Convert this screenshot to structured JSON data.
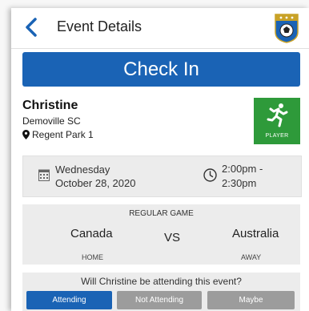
{
  "header": {
    "title": "Event Details",
    "back_icon": "chevron-left-icon",
    "logo_icon": "soccer-team-badge-icon"
  },
  "checkin": {
    "label": "Check In",
    "color": "#1a63b5"
  },
  "player": {
    "name": "Christine",
    "club": "Demoville SC",
    "location": "Regent Park 1",
    "role": "PLAYER",
    "role_color": "#2e9a3a",
    "role_icon": "runner-icon"
  },
  "schedule": {
    "day": "Wednesday",
    "date": "October 28, 2020",
    "time_start": "2:00pm -",
    "time_end": "2:30pm"
  },
  "game": {
    "type": "REGULAR GAME",
    "home_team": "Canada",
    "away_team": "Australia",
    "vs": "VS",
    "home_label": "HOME",
    "away_label": "AWAY"
  },
  "attendance": {
    "question": "Will Christine be attending this event?",
    "options": [
      "Attending",
      "Not Attending",
      "Maybe"
    ],
    "selected": "Attending"
  }
}
